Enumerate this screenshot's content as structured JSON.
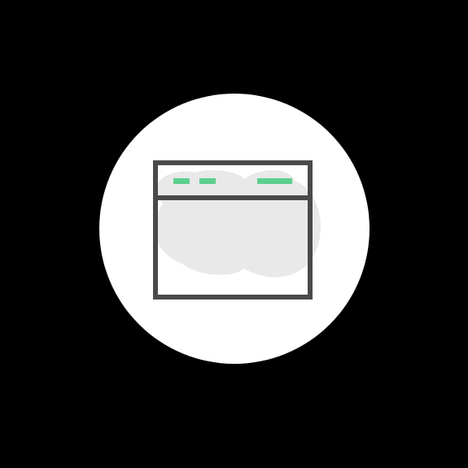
{
  "colors": {
    "background": "#000000",
    "circle": "#ffffff",
    "cloud": "#e9e9e9",
    "frame": "#4a4a4a",
    "accent": "#5ecf8f"
  },
  "icon": {
    "name": "browser-window-icon"
  }
}
